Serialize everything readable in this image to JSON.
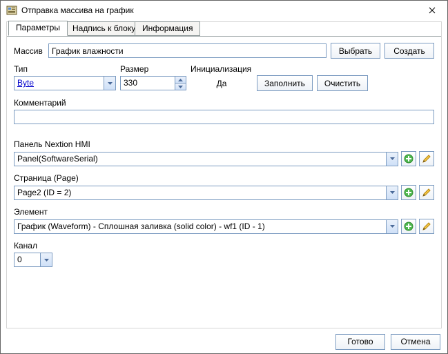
{
  "window": {
    "title": "Отправка массива на график"
  },
  "tabs": {
    "params": "Параметры",
    "blockLabel": "Надпись к блоку",
    "info": "Информация"
  },
  "labels": {
    "array": "Массив",
    "type": "Тип",
    "size": "Размер",
    "init": "Инициализация",
    "initValue": "Да",
    "comment": "Комментарий",
    "panel": "Панель Nextion HMI",
    "page": "Страница (Page)",
    "element": "Элемент",
    "channel": "Канал"
  },
  "values": {
    "array": "График влажности",
    "type": "Byte",
    "size": "330",
    "comment": "",
    "panel": "Panel(SoftwareSerial)",
    "page": "Page2 (ID = 2)",
    "element": "График (Waveform) - Сплошная заливка (solid color) - wf1 (ID - 1)",
    "channel": "0"
  },
  "buttons": {
    "select": "Выбрать",
    "create": "Создать",
    "fill": "Заполнить",
    "clear": "Очистить",
    "ok": "Готово",
    "cancel": "Отмена"
  }
}
